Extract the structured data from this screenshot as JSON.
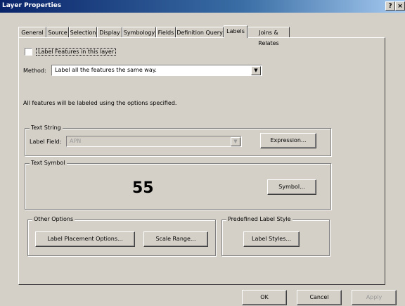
{
  "window": {
    "title": "Layer Properties",
    "help": "?",
    "close": "×"
  },
  "tabs": [
    "General",
    "Source",
    "Selection",
    "Display",
    "Symbology",
    "Fields",
    "Definition Query",
    "Labels",
    "Joins & Relates"
  ],
  "labels_tab": {
    "label_features_checkbox": "Label Features in this layer",
    "method_label": "Method:",
    "method_value": "Label all the features the same way.",
    "info_text": "All features will be labeled using the options specified.",
    "text_string": {
      "group_label": "Text String",
      "field_label": "Label Field:",
      "field_value": "APN",
      "expression_button": "Expression..."
    },
    "text_symbol": {
      "group_label": "Text Symbol",
      "preview_text": "55",
      "symbol_button": "Symbol..."
    },
    "other_options": {
      "group_label": "Other Options",
      "placement_button": "Label Placement Options...",
      "scale_button": "Scale Range..."
    },
    "predefined": {
      "group_label": "Predefined Label Style",
      "styles_button": "Label Styles..."
    }
  },
  "footer": {
    "ok": "OK",
    "cancel": "Cancel",
    "apply": "Apply"
  }
}
